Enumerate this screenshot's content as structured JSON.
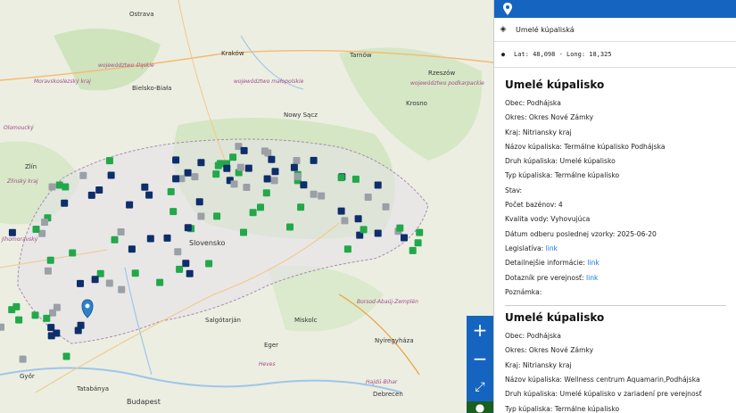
{
  "map": {
    "cities": [
      "Ostrava",
      "Bielsko-Biała",
      "Kraków",
      "Nowy Sącz",
      "Tarnów",
      "Krosno",
      "Rzeszów",
      "Zlín",
      "Slovensko",
      "Salgótarján",
      "Eger",
      "Miskolc",
      "Nyíregyháza",
      "Debrecen",
      "Budapest",
      "Győr",
      "Tatabánya"
    ],
    "regions": [
      "województwo śląskie",
      "województwo małopolskie",
      "województwo podkarpackie",
      "Moravskoslezský kraj",
      "Olomoucký",
      "Zlínský kraj",
      "Jihomoravský",
      "Borsod-Abaúj-Zemplén",
      "Heves",
      "Hajdú-Bihar"
    ],
    "marker_colors": {
      "navy": "#0d2e6b",
      "green": "#22a84a",
      "gray": "#9aa0a6",
      "pin": "#2b82cb"
    }
  },
  "controls": {
    "zoom_in": "+",
    "zoom_out": "−",
    "fullscreen": "⤢",
    "locate": "⚲"
  },
  "panel": {
    "search_value": "Umelé kúpaliská",
    "coords": "Lat: 48,098 - Long: 18,325",
    "records": [
      {
        "title": "Umelé kúpalisko",
        "lines": [
          {
            "label": "Obec:",
            "value": "Podhájska"
          },
          {
            "label": "Okres:",
            "value": "Okres Nové Zámky"
          },
          {
            "label": "Kraj:",
            "value": "Nitriansky kraj"
          },
          {
            "label": "Názov kúpaliska:",
            "value": "Termálne kúpalisko Podhájska"
          },
          {
            "label": "Druh kúpaliska:",
            "value": "Umelé kúpalisko"
          },
          {
            "label": "Typ kúpaliska:",
            "value": "Termálne kúpalisko"
          },
          {
            "label": "Stav:",
            "value": ""
          },
          {
            "label": "Počet bazénov:",
            "value": "4"
          },
          {
            "label": "Kvalita vody:",
            "value": "Vyhovujúca"
          },
          {
            "label": "Dátum odberu poslednej vzorky:",
            "value": "2025-06-20"
          }
        ],
        "legislativa_label": "Legislatíva:",
        "legislativa_link": "link",
        "detail_label": "Detailnejšie informácie:",
        "detail_link": "link",
        "dotaznik_label": "Dotazník pre verejnosť:",
        "dotaznik_link": "link",
        "poznamka_label": "Poznámka:"
      },
      {
        "title": "Umelé kúpalisko",
        "lines": [
          {
            "label": "Obec:",
            "value": "Podhájska"
          },
          {
            "label": "Okres:",
            "value": "Okres Nové Zámky"
          },
          {
            "label": "Kraj:",
            "value": "Nitriansky kraj"
          },
          {
            "label": "Názov kúpaliska:",
            "value": "Wellness centrum Aquamarin,Podhájska"
          },
          {
            "label": "Druh kúpaliska:",
            "value": "Umelé kúpalisko v zariadení pre verejnosť"
          },
          {
            "label": "Typ kúpaliska:",
            "value": "Termálne kúpalisko"
          }
        ]
      }
    ]
  }
}
